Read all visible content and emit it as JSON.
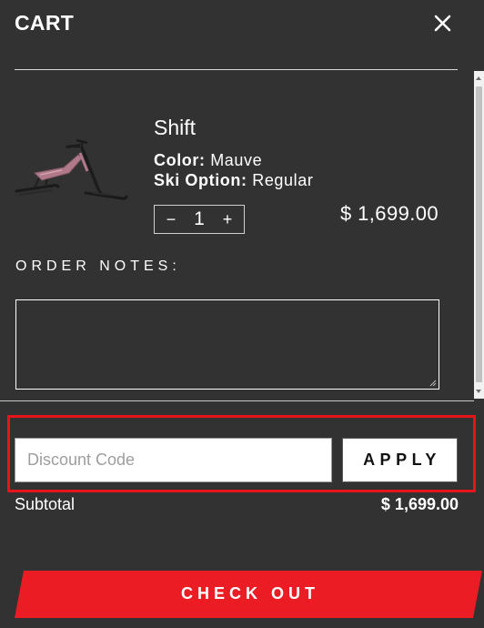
{
  "header": {
    "title": "CART",
    "close_icon": "close-icon"
  },
  "product": {
    "name": "Shift",
    "image_icon": "snow-bike-image",
    "color_label": "Color:",
    "color_value": "Mauve",
    "ski_label": "Ski Option:",
    "ski_value": "Regular",
    "quantity": "1",
    "minus_symbol": "−",
    "plus_symbol": "+",
    "price": "$ 1,699.00"
  },
  "order_notes": {
    "label": "ORDER NOTES:",
    "value": ""
  },
  "discount": {
    "placeholder": "Discount Code",
    "apply_label": "APPLY",
    "highlight_color": "#e8141c"
  },
  "subtotal": {
    "label": "Subtotal",
    "value": "$ 1,699.00"
  },
  "checkout": {
    "label": "CHECK OUT",
    "color": "#ec1c24"
  },
  "colors": {
    "background": "#323232",
    "text": "#ffffff",
    "accent": "#ec1c24"
  }
}
